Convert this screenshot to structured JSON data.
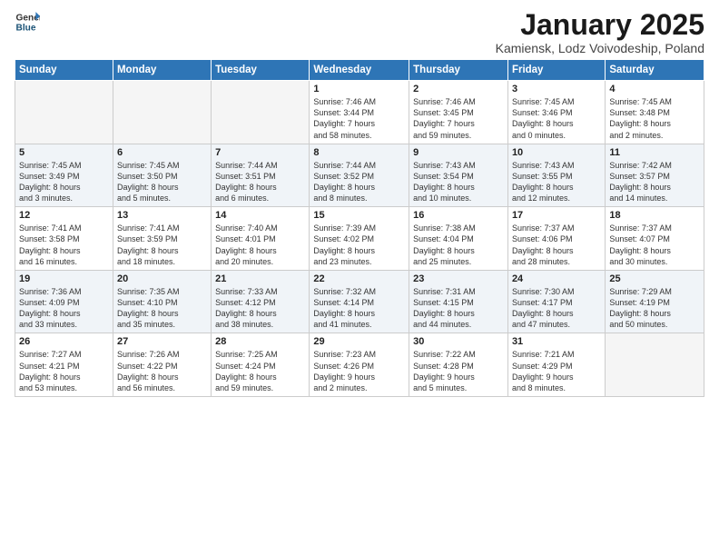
{
  "logo": {
    "general": "General",
    "blue": "Blue"
  },
  "title": "January 2025",
  "location": "Kamiensk, Lodz Voivodeship, Poland",
  "days_of_week": [
    "Sunday",
    "Monday",
    "Tuesday",
    "Wednesday",
    "Thursday",
    "Friday",
    "Saturday"
  ],
  "weeks": [
    [
      {
        "day": "",
        "info": ""
      },
      {
        "day": "",
        "info": ""
      },
      {
        "day": "",
        "info": ""
      },
      {
        "day": "1",
        "info": "Sunrise: 7:46 AM\nSunset: 3:44 PM\nDaylight: 7 hours\nand 58 minutes."
      },
      {
        "day": "2",
        "info": "Sunrise: 7:46 AM\nSunset: 3:45 PM\nDaylight: 7 hours\nand 59 minutes."
      },
      {
        "day": "3",
        "info": "Sunrise: 7:45 AM\nSunset: 3:46 PM\nDaylight: 8 hours\nand 0 minutes."
      },
      {
        "day": "4",
        "info": "Sunrise: 7:45 AM\nSunset: 3:48 PM\nDaylight: 8 hours\nand 2 minutes."
      }
    ],
    [
      {
        "day": "5",
        "info": "Sunrise: 7:45 AM\nSunset: 3:49 PM\nDaylight: 8 hours\nand 3 minutes."
      },
      {
        "day": "6",
        "info": "Sunrise: 7:45 AM\nSunset: 3:50 PM\nDaylight: 8 hours\nand 5 minutes."
      },
      {
        "day": "7",
        "info": "Sunrise: 7:44 AM\nSunset: 3:51 PM\nDaylight: 8 hours\nand 6 minutes."
      },
      {
        "day": "8",
        "info": "Sunrise: 7:44 AM\nSunset: 3:52 PM\nDaylight: 8 hours\nand 8 minutes."
      },
      {
        "day": "9",
        "info": "Sunrise: 7:43 AM\nSunset: 3:54 PM\nDaylight: 8 hours\nand 10 minutes."
      },
      {
        "day": "10",
        "info": "Sunrise: 7:43 AM\nSunset: 3:55 PM\nDaylight: 8 hours\nand 12 minutes."
      },
      {
        "day": "11",
        "info": "Sunrise: 7:42 AM\nSunset: 3:57 PM\nDaylight: 8 hours\nand 14 minutes."
      }
    ],
    [
      {
        "day": "12",
        "info": "Sunrise: 7:41 AM\nSunset: 3:58 PM\nDaylight: 8 hours\nand 16 minutes."
      },
      {
        "day": "13",
        "info": "Sunrise: 7:41 AM\nSunset: 3:59 PM\nDaylight: 8 hours\nand 18 minutes."
      },
      {
        "day": "14",
        "info": "Sunrise: 7:40 AM\nSunset: 4:01 PM\nDaylight: 8 hours\nand 20 minutes."
      },
      {
        "day": "15",
        "info": "Sunrise: 7:39 AM\nSunset: 4:02 PM\nDaylight: 8 hours\nand 23 minutes."
      },
      {
        "day": "16",
        "info": "Sunrise: 7:38 AM\nSunset: 4:04 PM\nDaylight: 8 hours\nand 25 minutes."
      },
      {
        "day": "17",
        "info": "Sunrise: 7:37 AM\nSunset: 4:06 PM\nDaylight: 8 hours\nand 28 minutes."
      },
      {
        "day": "18",
        "info": "Sunrise: 7:37 AM\nSunset: 4:07 PM\nDaylight: 8 hours\nand 30 minutes."
      }
    ],
    [
      {
        "day": "19",
        "info": "Sunrise: 7:36 AM\nSunset: 4:09 PM\nDaylight: 8 hours\nand 33 minutes."
      },
      {
        "day": "20",
        "info": "Sunrise: 7:35 AM\nSunset: 4:10 PM\nDaylight: 8 hours\nand 35 minutes."
      },
      {
        "day": "21",
        "info": "Sunrise: 7:33 AM\nSunset: 4:12 PM\nDaylight: 8 hours\nand 38 minutes."
      },
      {
        "day": "22",
        "info": "Sunrise: 7:32 AM\nSunset: 4:14 PM\nDaylight: 8 hours\nand 41 minutes."
      },
      {
        "day": "23",
        "info": "Sunrise: 7:31 AM\nSunset: 4:15 PM\nDaylight: 8 hours\nand 44 minutes."
      },
      {
        "day": "24",
        "info": "Sunrise: 7:30 AM\nSunset: 4:17 PM\nDaylight: 8 hours\nand 47 minutes."
      },
      {
        "day": "25",
        "info": "Sunrise: 7:29 AM\nSunset: 4:19 PM\nDaylight: 8 hours\nand 50 minutes."
      }
    ],
    [
      {
        "day": "26",
        "info": "Sunrise: 7:27 AM\nSunset: 4:21 PM\nDaylight: 8 hours\nand 53 minutes."
      },
      {
        "day": "27",
        "info": "Sunrise: 7:26 AM\nSunset: 4:22 PM\nDaylight: 8 hours\nand 56 minutes."
      },
      {
        "day": "28",
        "info": "Sunrise: 7:25 AM\nSunset: 4:24 PM\nDaylight: 8 hours\nand 59 minutes."
      },
      {
        "day": "29",
        "info": "Sunrise: 7:23 AM\nSunset: 4:26 PM\nDaylight: 9 hours\nand 2 minutes."
      },
      {
        "day": "30",
        "info": "Sunrise: 7:22 AM\nSunset: 4:28 PM\nDaylight: 9 hours\nand 5 minutes."
      },
      {
        "day": "31",
        "info": "Sunrise: 7:21 AM\nSunset: 4:29 PM\nDaylight: 9 hours\nand 8 minutes."
      },
      {
        "day": "",
        "info": ""
      }
    ]
  ]
}
